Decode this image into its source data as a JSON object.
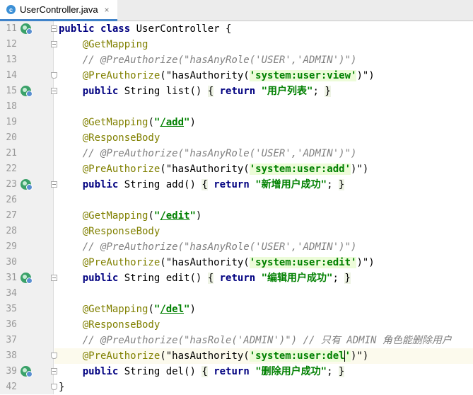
{
  "tab": {
    "icon_letter": "c",
    "file_name": "UserController.java",
    "close_glyph": "×"
  },
  "lines": [
    {
      "n": "11",
      "icon": true,
      "fold": "minus",
      "code": [
        {
          "t": "public class",
          "c": "kw"
        },
        {
          "t": " UserController {"
        }
      ]
    },
    {
      "n": "12",
      "fold": "minus",
      "code": [
        {
          "t": "    "
        },
        {
          "t": "@GetMapping",
          "c": "ann"
        }
      ]
    },
    {
      "n": "13",
      "code": [
        {
          "t": "    "
        },
        {
          "t": "// @PreAuthorize(\"hasAnyRole('USER','ADMIN')\")",
          "c": "cmt"
        }
      ]
    },
    {
      "n": "14",
      "fold": "cap",
      "code": [
        {
          "t": "    "
        },
        {
          "t": "@PreAuthorize",
          "c": "ann"
        },
        {
          "t": "(\"hasAuthority("
        },
        {
          "t": "'system:user:view'",
          "c": "str sqln"
        },
        {
          "t": ")\")"
        }
      ]
    },
    {
      "n": "15",
      "icon": true,
      "fold": "minus",
      "code": [
        {
          "t": "    "
        },
        {
          "t": "public",
          "c": "kw"
        },
        {
          "t": " String list() "
        },
        {
          "t": "{",
          "c": "br"
        },
        {
          "t": " "
        },
        {
          "t": "return",
          "c": "kw"
        },
        {
          "t": " "
        },
        {
          "t": "\"用户列表\"",
          "c": "str"
        },
        {
          "t": "; "
        },
        {
          "t": "}",
          "c": "br"
        }
      ]
    },
    {
      "n": "18",
      "code": []
    },
    {
      "n": "19",
      "code": [
        {
          "t": "    "
        },
        {
          "t": "@GetMapping",
          "c": "ann"
        },
        {
          "t": "("
        },
        {
          "t": "\"",
          "c": "str"
        },
        {
          "t": "/add",
          "c": "str ul"
        },
        {
          "t": "\"",
          "c": "str"
        },
        {
          "t": ")"
        }
      ]
    },
    {
      "n": "20",
      "code": [
        {
          "t": "    "
        },
        {
          "t": "@ResponseBody",
          "c": "ann"
        }
      ]
    },
    {
      "n": "21",
      "code": [
        {
          "t": "    "
        },
        {
          "t": "// @PreAuthorize(\"hasAnyRole('USER','ADMIN')\")",
          "c": "cmt"
        }
      ]
    },
    {
      "n": "22",
      "code": [
        {
          "t": "    "
        },
        {
          "t": "@PreAuthorize",
          "c": "ann"
        },
        {
          "t": "(\"hasAuthority("
        },
        {
          "t": "'system:user:add'",
          "c": "str sqln"
        },
        {
          "t": ")\")"
        }
      ]
    },
    {
      "n": "23",
      "icon": true,
      "fold": "minus",
      "code": [
        {
          "t": "    "
        },
        {
          "t": "public",
          "c": "kw"
        },
        {
          "t": " String add() "
        },
        {
          "t": "{",
          "c": "br"
        },
        {
          "t": " "
        },
        {
          "t": "return",
          "c": "kw"
        },
        {
          "t": " "
        },
        {
          "t": "\"新增用户成功\"",
          "c": "str"
        },
        {
          "t": "; "
        },
        {
          "t": "}",
          "c": "br"
        }
      ]
    },
    {
      "n": "26",
      "code": []
    },
    {
      "n": "27",
      "code": [
        {
          "t": "    "
        },
        {
          "t": "@GetMapping",
          "c": "ann"
        },
        {
          "t": "("
        },
        {
          "t": "\"",
          "c": "str"
        },
        {
          "t": "/edit",
          "c": "str ul"
        },
        {
          "t": "\"",
          "c": "str"
        },
        {
          "t": ")"
        }
      ]
    },
    {
      "n": "28",
      "code": [
        {
          "t": "    "
        },
        {
          "t": "@ResponseBody",
          "c": "ann"
        }
      ]
    },
    {
      "n": "29",
      "code": [
        {
          "t": "    "
        },
        {
          "t": "// @PreAuthorize(\"hasAnyRole('USER','ADMIN')\")",
          "c": "cmt"
        }
      ]
    },
    {
      "n": "30",
      "code": [
        {
          "t": "    "
        },
        {
          "t": "@PreAuthorize",
          "c": "ann"
        },
        {
          "t": "(\"hasAuthority("
        },
        {
          "t": "'system:user:edit'",
          "c": "str sqln"
        },
        {
          "t": ")\")"
        }
      ]
    },
    {
      "n": "31",
      "icon": true,
      "fold": "minus",
      "code": [
        {
          "t": "    "
        },
        {
          "t": "public",
          "c": "kw"
        },
        {
          "t": " String edit() "
        },
        {
          "t": "{",
          "c": "br"
        },
        {
          "t": " "
        },
        {
          "t": "return",
          "c": "kw"
        },
        {
          "t": " "
        },
        {
          "t": "\"编辑用户成功\"",
          "c": "str"
        },
        {
          "t": "; "
        },
        {
          "t": "}",
          "c": "br"
        }
      ]
    },
    {
      "n": "34",
      "code": []
    },
    {
      "n": "35",
      "code": [
        {
          "t": "    "
        },
        {
          "t": "@GetMapping",
          "c": "ann"
        },
        {
          "t": "("
        },
        {
          "t": "\"",
          "c": "str"
        },
        {
          "t": "/del",
          "c": "str ul"
        },
        {
          "t": "\"",
          "c": "str"
        },
        {
          "t": ")"
        }
      ]
    },
    {
      "n": "36",
      "code": [
        {
          "t": "    "
        },
        {
          "t": "@ResponseBody",
          "c": "ann"
        }
      ]
    },
    {
      "n": "37",
      "code": [
        {
          "t": "    "
        },
        {
          "t": "// @PreAuthorize(\"hasRole('ADMIN')\") // 只有 ADMIN 角色能删除用户",
          "c": "cmt"
        }
      ]
    },
    {
      "n": "38",
      "current": true,
      "fold": "cap",
      "code": [
        {
          "t": "    "
        },
        {
          "t": "@PreAuthorize",
          "c": "ann"
        },
        {
          "t": "(\"hasAuthority("
        },
        {
          "t": "'system:user:del",
          "c": "str sqln"
        },
        {
          "caret": true
        },
        {
          "t": "'",
          "c": "str sqln"
        },
        {
          "t": ")\")"
        }
      ]
    },
    {
      "n": "39",
      "icon": true,
      "fold": "minus",
      "code": [
        {
          "t": "    "
        },
        {
          "t": "public",
          "c": "kw"
        },
        {
          "t": " String del() "
        },
        {
          "t": "{",
          "c": "br"
        },
        {
          "t": " "
        },
        {
          "t": "return",
          "c": "kw"
        },
        {
          "t": " "
        },
        {
          "t": "\"删除用户成功\"",
          "c": "str"
        },
        {
          "t": "; "
        },
        {
          "t": "}",
          "c": "br"
        }
      ]
    },
    {
      "n": "42",
      "fold": "cap",
      "code": [
        {
          "t": "}"
        }
      ]
    }
  ]
}
